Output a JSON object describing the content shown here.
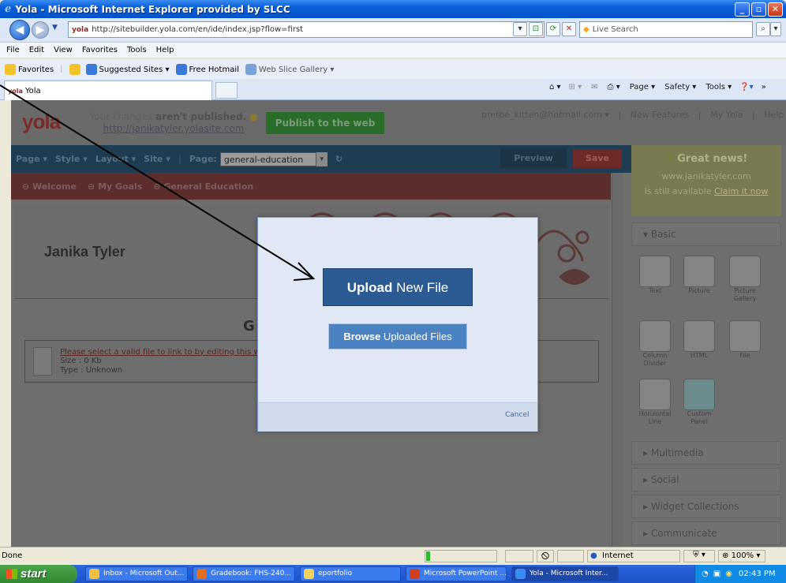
{
  "window": {
    "title": "Yola - Microsoft Internet Explorer provided by SLCC"
  },
  "address": {
    "url": "http://sitebuilder.yola.com/en/ide/index.jsp?flow=first",
    "search_placeholder": "Live Search"
  },
  "menu": [
    "File",
    "Edit",
    "View",
    "Favorites",
    "Tools",
    "Help"
  ],
  "favorites": {
    "label": "Favorites",
    "items": [
      "Suggested Sites ▾",
      "Free Hotmail",
      "Web Slice Gallery ▾"
    ]
  },
  "tab": {
    "label": "Yola"
  },
  "commandbar": [
    "Page ▾",
    "Safety ▾",
    "Tools ▾"
  ],
  "yola": {
    "logo": "yola",
    "publish_line1": "Your changes ",
    "publish_bold": "aren't published.",
    "publish_url": "http://janikatyler.yolasite.com",
    "publish_button": "Publish to the web",
    "user": "pretbe_kitten@hotmail.com ▾",
    "links": [
      "New Features",
      "My Yola",
      "Help ▾"
    ],
    "editbar": {
      "menus": [
        "Page ▾",
        "Style ▾",
        "Layout ▾",
        "Site ▾"
      ],
      "page_label": "Page:",
      "page_value": "general-education",
      "preview": "Preview",
      "save": "Save"
    },
    "nav": [
      "Welcome",
      "My Goals",
      "General Education"
    ],
    "site_title": "Janika Tyler",
    "section_title": "G",
    "file_link": "Please select a valid file to link to by editing this widg",
    "file_size": "Size : 0 Kb",
    "file_type": "Type : Unknown",
    "right_panel": {
      "news_title": "Great news!",
      "news_domain": "www.janikatyler.com",
      "news_text": "Is still available ",
      "news_link": "Claim it now",
      "sections": [
        "Basic",
        "Multimedia",
        "Social",
        "Widget Collections",
        "Communicate"
      ],
      "widgets": [
        "Text",
        "Picture",
        "Picture Gallery",
        "Column Divider",
        "HTML",
        "File",
        "Horizontal Line",
        "Custom Panel"
      ]
    }
  },
  "dialog": {
    "upload_bold": "Upload",
    "upload_rest": " New File",
    "browse_bold": "Browse",
    "browse_rest": " Uploaded Files",
    "cancel": "Cancel"
  },
  "status": {
    "text": "Done",
    "zone": "Internet",
    "zoom": "100%"
  },
  "taskbar": {
    "start": "start",
    "items": [
      "Inbox - Microsoft Out...",
      "Gradebook: FHS-240...",
      "eportfolio",
      "Microsoft PowerPoint ...",
      "Yola - Microsoft Inter..."
    ],
    "clock": "02:43 PM"
  }
}
